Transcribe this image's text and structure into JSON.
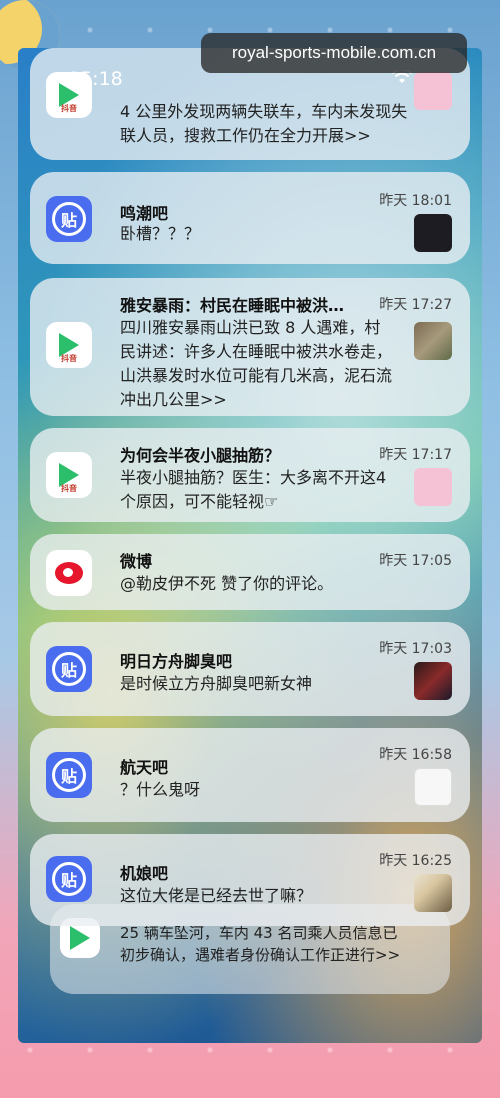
{
  "status_bar": {
    "time": "15:18"
  },
  "watermark": "royal-sports-mobile.com.cn",
  "notifications": [
    {
      "app_icon": "video-app-icon",
      "title": "",
      "time": "",
      "body": "4 公里外发现两辆失联车，车内未发现失联人员，搜救工作仍在全力开展>>"
    },
    {
      "app_icon": "tieba-icon",
      "title": "鸣潮吧",
      "time": "昨天 18:01",
      "body": "卧槽？？？"
    },
    {
      "app_icon": "video-app-icon",
      "title": "雅安暴雨：村民在睡眠中被洪…",
      "time": "昨天 17:27",
      "body": "四川雅安暴雨山洪已致 8 人遇难，村民讲述：许多人在睡眠中被洪水卷走，山洪暴发时水位可能有几米高，泥石流冲出几公里>>"
    },
    {
      "app_icon": "video-app-icon",
      "title": "为何会半夜小腿抽筋？",
      "time": "昨天 17:17",
      "body": "半夜小腿抽筋？医生：大多离不开这4个原因，可不能轻视☞"
    },
    {
      "app_icon": "weibo-icon",
      "title": "微博",
      "time": "昨天 17:05",
      "body": "@勒皮伊不死 赞了你的评论。"
    },
    {
      "app_icon": "tieba-icon",
      "title": "明日方舟脚臭吧",
      "time": "昨天 17:03",
      "body": "是时候立方舟脚臭吧新女神"
    },
    {
      "app_icon": "tieba-icon",
      "title": "航天吧",
      "time": "昨天 16:58",
      "body": "？什么鬼呀"
    },
    {
      "app_icon": "tieba-icon",
      "title": "机娘吧",
      "time": "昨天 16:25",
      "body": "这位大佬是已经去世了嘛？"
    },
    {
      "app_icon": "video-app-icon",
      "title": "",
      "time": "",
      "body": "25 辆车坠河，车内 43 名司乘人员信息已初步确认，遇难者身份确认工作正进行>>"
    }
  ],
  "icon_labels": {
    "tieba": "贴",
    "video_sub": "抖音"
  }
}
